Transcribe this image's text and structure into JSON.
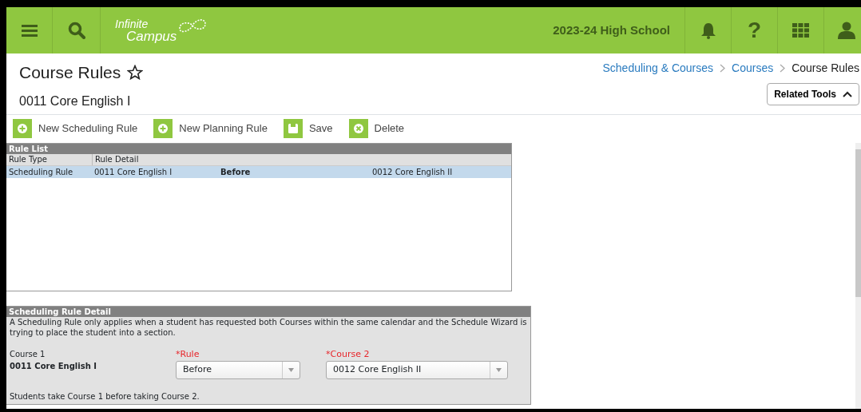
{
  "header": {
    "logo": {
      "line1": "Infinite",
      "line2": "Campus"
    },
    "school": "2023-24 High School",
    "help_glyph": "?"
  },
  "page": {
    "title": "Course Rules",
    "favorite": false,
    "subtitle": "0011 Core English I"
  },
  "breadcrumbs": [
    {
      "label": "Scheduling & Courses",
      "link": true
    },
    {
      "label": "Courses",
      "link": true
    },
    {
      "label": "Course Rules",
      "link": false
    }
  ],
  "related_tools": {
    "label": "Related Tools",
    "expanded": true
  },
  "toolbar": [
    {
      "label": "New Scheduling Rule",
      "kind": "add"
    },
    {
      "label": "New Planning Rule",
      "kind": "add"
    },
    {
      "label": "Save",
      "kind": "save"
    },
    {
      "label": "Delete",
      "kind": "delete"
    }
  ],
  "rule_list": {
    "title": "Rule List",
    "columns": [
      "Rule Type",
      "Rule Detail"
    ],
    "rows": [
      {
        "type": "Scheduling Rule",
        "course_1": "0011 Core English I",
        "rule": "Before",
        "course_2": "0012 Core English II",
        "selected": true
      }
    ]
  },
  "detail": {
    "title": "Scheduling Rule Detail",
    "description": "A Scheduling Rule only applies when a student has requested both Courses within the same calendar and the Schedule Wizard is trying to place the student into a section.",
    "course_1": {
      "label": "Course 1",
      "value": "0011 Core English I"
    },
    "rule": {
      "label": "*Rule",
      "value": "Before"
    },
    "course_2": {
      "label": "*Course 2",
      "value": "0012 Core English II"
    },
    "summary": "Students take Course 1 before taking Course 2."
  }
}
